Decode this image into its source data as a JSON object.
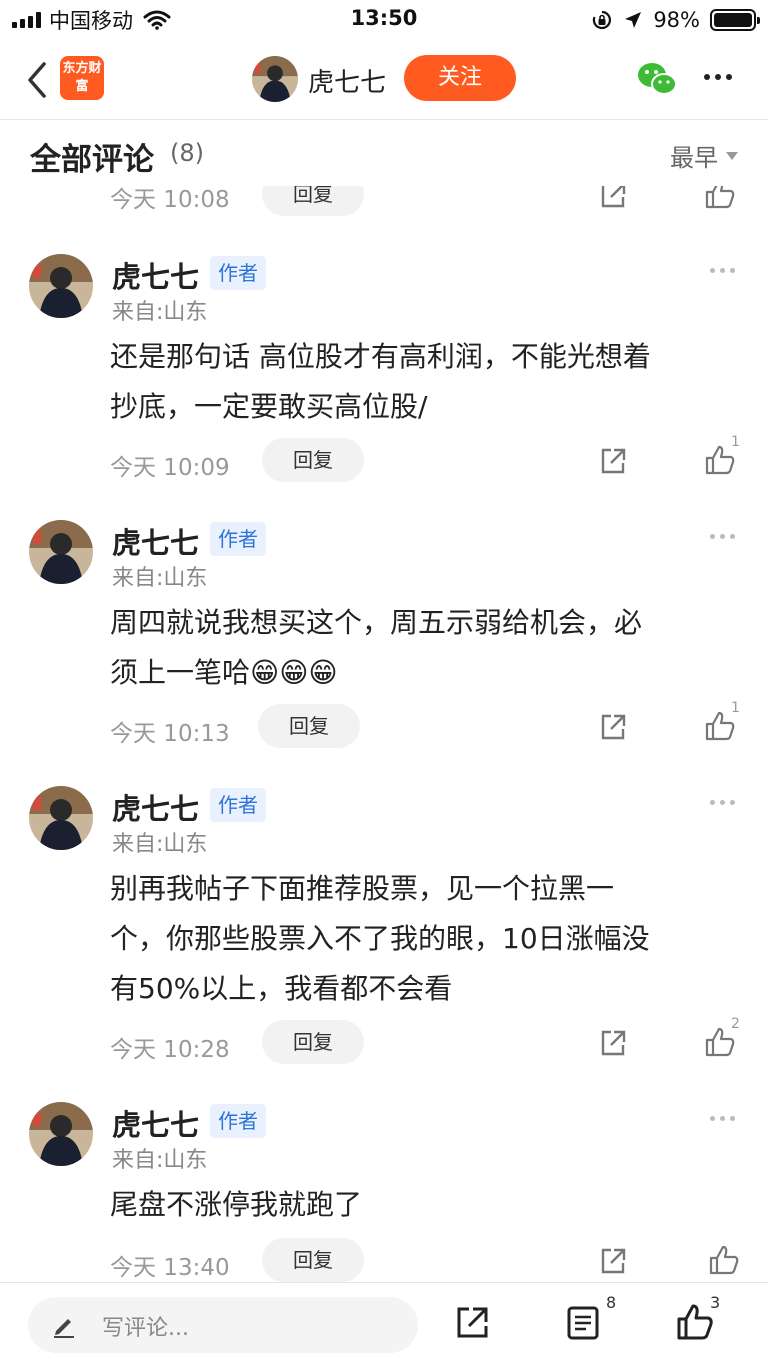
{
  "status_bar": {
    "carrier": "中国移动",
    "time": "13:50",
    "battery": "98%"
  },
  "nav": {
    "logo": "东方财富",
    "title": "虎七七",
    "follow_label": "关注"
  },
  "comments_header": {
    "title": "全部评论",
    "count": "(8)",
    "sort_label": "最早"
  },
  "partial_row": {
    "time": "今天 10:08",
    "reply_label": "回复"
  },
  "comments": [
    {
      "author": "虎七七",
      "tag": "作者",
      "location": "来自:山东",
      "lines": [
        "还是那句话 高位股才有高利润，不能光想着",
        "抄底，一定要敢买高位股/"
      ],
      "time": "今天 10:09",
      "reply_label": "回复",
      "likes": "1"
    },
    {
      "author": "虎七七",
      "tag": "作者",
      "location": "来自:山东",
      "lines": [
        "周四就说我想买这个，周五示弱给机会，必",
        "须上一笔哈😁😁😁"
      ],
      "time": "今天 10:13",
      "reply_label": "回复",
      "likes": "1"
    },
    {
      "author": "虎七七",
      "tag": "作者",
      "location": "来自:山东",
      "lines": [
        "别再我帖子下面推荐股票，见一个拉黑一",
        "个，你那些股票入不了我的眼，10日涨幅没",
        "有50%以上，我看都不会看"
      ],
      "time": "今天 10:28",
      "reply_label": "回复",
      "likes": "2"
    },
    {
      "author": "虎七七",
      "tag": "作者",
      "location": "来自:山东",
      "lines": [
        "尾盘不涨停我就跑了"
      ],
      "time": "今天 13:40",
      "reply_label": "回复",
      "likes": ""
    }
  ],
  "bottom_bar": {
    "input_placeholder": "写评论...",
    "list_count": "8",
    "like_count": "3"
  },
  "colors": {
    "brand_orange": "#ff5a1f",
    "tag_blue": "#2e74d6",
    "tag_bg": "#e8f1fd",
    "wechat_green": "#3dbb35"
  },
  "icons": [
    "back-chevron-icon",
    "wechat-icon",
    "more-dots-icon",
    "share-icon",
    "like-icon",
    "pencil-icon",
    "list-icon"
  ]
}
